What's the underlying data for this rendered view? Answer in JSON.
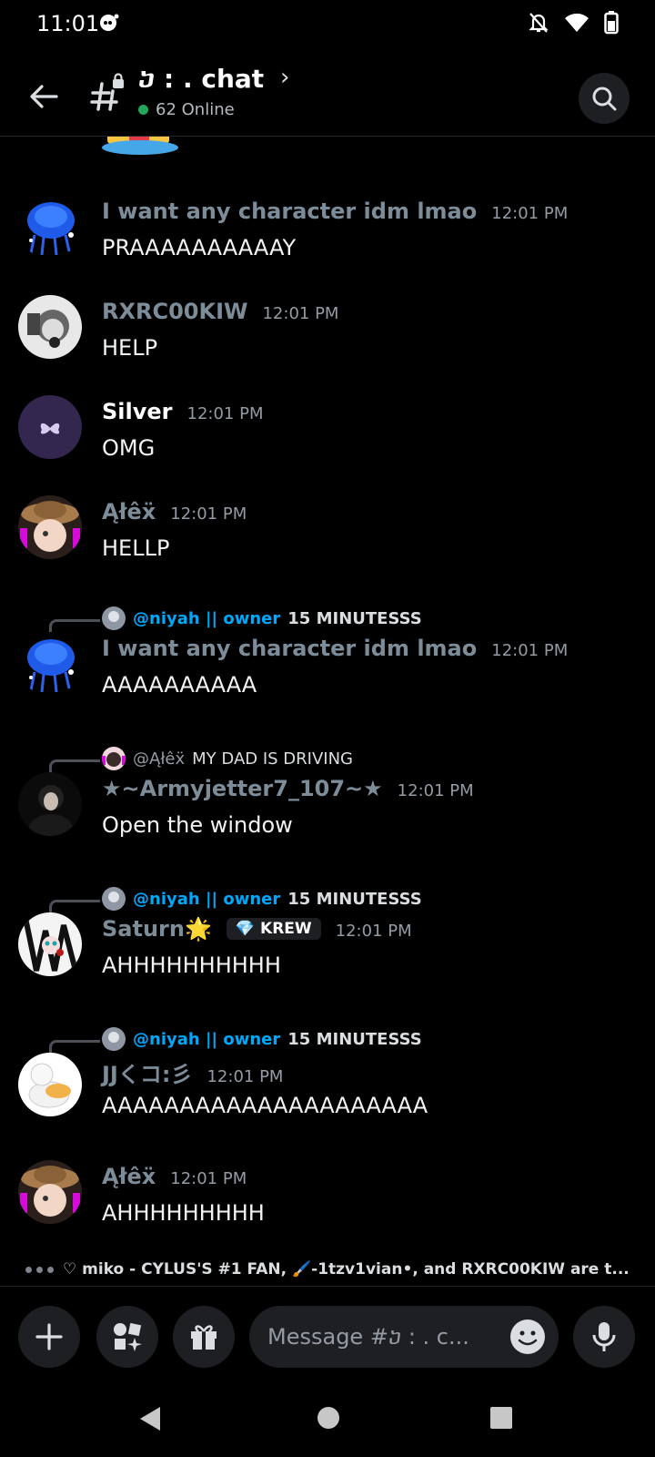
{
  "status_bar": {
    "time": "11:01"
  },
  "header": {
    "channel_name": "ⴢ :  . chat",
    "online_text": "62 Online"
  },
  "messages": [
    {
      "author": "I want any character idm lmao",
      "author_color": "#7d8c99",
      "time": "12:01 PM",
      "text": "PRAAAAAAAAAAY"
    },
    {
      "author": "RXRC00KIW",
      "author_color": "#7d8c99",
      "time": "12:01 PM",
      "text": "HELP"
    },
    {
      "author": "Silver",
      "author_color": "#ffffff",
      "time": "12:01 PM",
      "text": "OMG"
    },
    {
      "author": "Ąłêẍ",
      "author_color": "#7d8c99",
      "time": "12:01 PM",
      "text": "HELLP"
    },
    {
      "reply_mention": "@niyah || owner",
      "reply_text": "15 MINUTESSS",
      "author": "I want any character idm lmao",
      "author_color": "#7d8c99",
      "time": "12:01 PM",
      "text": "AAAAAAAAAA"
    },
    {
      "reply_mention": "@Ąłêẍ",
      "reply_text": "MY DAD IS DRIVING",
      "author": "★~Armyjetter7_107~★",
      "author_color": "#7d8c99",
      "time": "12:01 PM",
      "text": "Open the window"
    },
    {
      "reply_mention": "@niyah || owner",
      "reply_text": "15 MINUTESSS",
      "author": "Saturn🌟",
      "author_color": "#7d8c99",
      "badge": "KREW",
      "time": "12:01 PM",
      "text": "AHHHHHHHHHH"
    },
    {
      "reply_mention": "@niyah || owner",
      "reply_text": "15 MINUTESSS",
      "author": "JJくコ:彡",
      "author_color": "#7d8c99",
      "time": "12:01 PM",
      "text": "AAAAAAAAAAAAAAAAAAAAA"
    },
    {
      "author": "Ąłêẍ",
      "author_color": "#7d8c99",
      "time": "12:01 PM",
      "text": "AHHHHHHHHH"
    }
  ],
  "typing": {
    "pre": "miko - CYLUS'S #1 FAN, ",
    "mid": "-1tzv1vian•, and ",
    "post": "RXRC00KIW are t..."
  },
  "composer": {
    "placeholder": "Message #ⴢ :  . c..."
  }
}
